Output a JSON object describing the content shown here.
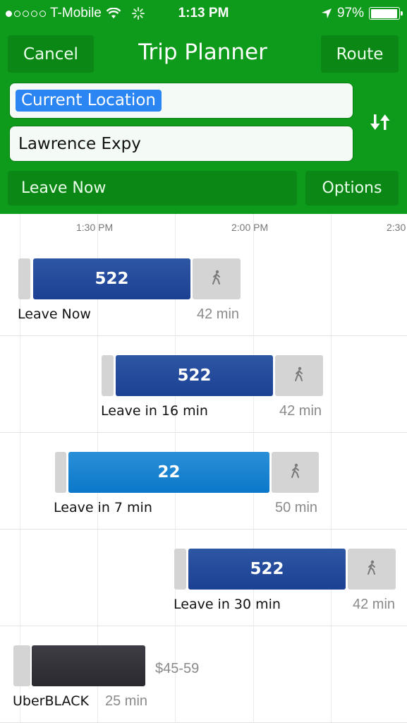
{
  "status_bar": {
    "signal_dots_filled": 1,
    "signal_dots_total": 5,
    "carrier": "T-Mobile",
    "time": "1:13 PM",
    "battery_pct": "97%",
    "battery_level": 0.97,
    "icons": [
      "wifi-icon",
      "activity-spinner-icon",
      "location-arrow-icon",
      "battery-icon"
    ]
  },
  "header": {
    "cancel_label": "Cancel",
    "title": "Trip Planner",
    "route_label": "Route",
    "from_value": "Current Location",
    "to_value": "Lawrence Expy",
    "swap_icon": "swap-arrows-icon",
    "leave_label": "Leave Now",
    "options_label": "Options",
    "brand_color": "#0e9a1a"
  },
  "timeline": {
    "ticks": [
      "1:30 PM",
      "2:00 PM",
      "2:30"
    ],
    "trips": [
      {
        "route": "522",
        "label": "Leave Now",
        "duration": "42 min",
        "color": "#1f4797"
      },
      {
        "route": "522",
        "label": "Leave in 16 min",
        "duration": "42 min",
        "color": "#1f4797"
      },
      {
        "route": "22",
        "label": "Leave in 7 min",
        "duration": "50 min",
        "color": "#1282cf"
      },
      {
        "route": "522",
        "label": "Leave in 30 min",
        "duration": "42 min",
        "color": "#1f4797"
      }
    ],
    "uber": {
      "label": "UberBLACK",
      "duration": "25 min",
      "price": "$45-59",
      "color": "#33323a"
    }
  }
}
